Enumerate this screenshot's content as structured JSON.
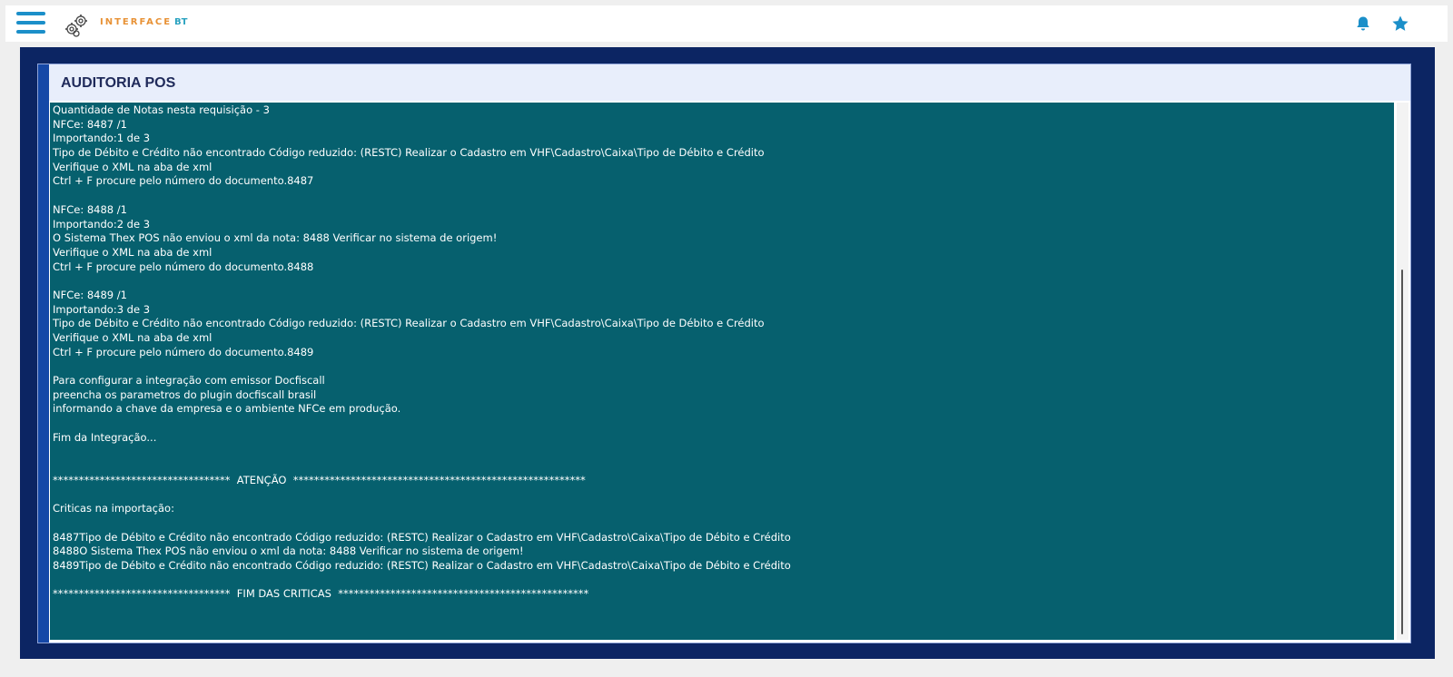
{
  "header": {
    "logo_text": "INTERFACE",
    "logo_sub": "BT"
  },
  "panel": {
    "title": "AUDITORIA POS"
  },
  "log_lines": [
    "Quantidade de Notas nesta requisição - 3",
    "NFCe: 8487 /1",
    "Importando:1 de 3",
    "Tipo de Débito e Crédito não encontrado Código reduzido: (RESTC) Realizar o Cadastro em VHF\\Cadastro\\Caixa\\Tipo de Débito e Crédito",
    "Verifique o XML na aba de xml",
    "Ctrl + F procure pelo número do documento.8487",
    "",
    "NFCe: 8488 /1",
    "Importando:2 de 3",
    "O Sistema Thex POS não enviou o xml da nota: 8488 Verificar no sistema de origem!",
    "Verifique o XML na aba de xml",
    "Ctrl + F procure pelo número do documento.8488",
    "",
    "NFCe: 8489 /1",
    "Importando:3 de 3",
    "Tipo de Débito e Crédito não encontrado Código reduzido: (RESTC) Realizar o Cadastro em VHF\\Cadastro\\Caixa\\Tipo de Débito e Crédito",
    "Verifique o XML na aba de xml",
    "Ctrl + F procure pelo número do documento.8489",
    "",
    "Para configurar a integração com emissor Docfiscall",
    "preencha os parametros do plugin docfiscall brasil",
    "informando a chave da empresa e o ambiente NFCe em produção.",
    "",
    "Fim da Integração...",
    "",
    "",
    "**********************************  ATENÇÃO  ********************************************************",
    "",
    "Criticas na importação:",
    "",
    "8487Tipo de Débito e Crédito não encontrado Código reduzido: (RESTC) Realizar o Cadastro em VHF\\Cadastro\\Caixa\\Tipo de Débito e Crédito",
    "8488O Sistema Thex POS não enviou o xml da nota: 8488 Verificar no sistema de origem!",
    "8489Tipo de Débito e Crédito não encontrado Código reduzido: (RESTC) Realizar o Cadastro em VHF\\Cadastro\\Caixa\\Tipo de Débito e Crédito",
    "",
    "**********************************  FIM DAS CRITICAS  ************************************************"
  ],
  "colors": {
    "log_background": "#06606e",
    "frame": "#0c2563",
    "accent": "#1548a7",
    "brand_orange": "#e89236",
    "brand_blue": "#1b8fc9"
  },
  "icons": {
    "menu": "hamburger-icon",
    "logo": "gears-logo-icon",
    "notifications": "bell-icon",
    "favorites": "star-icon"
  }
}
